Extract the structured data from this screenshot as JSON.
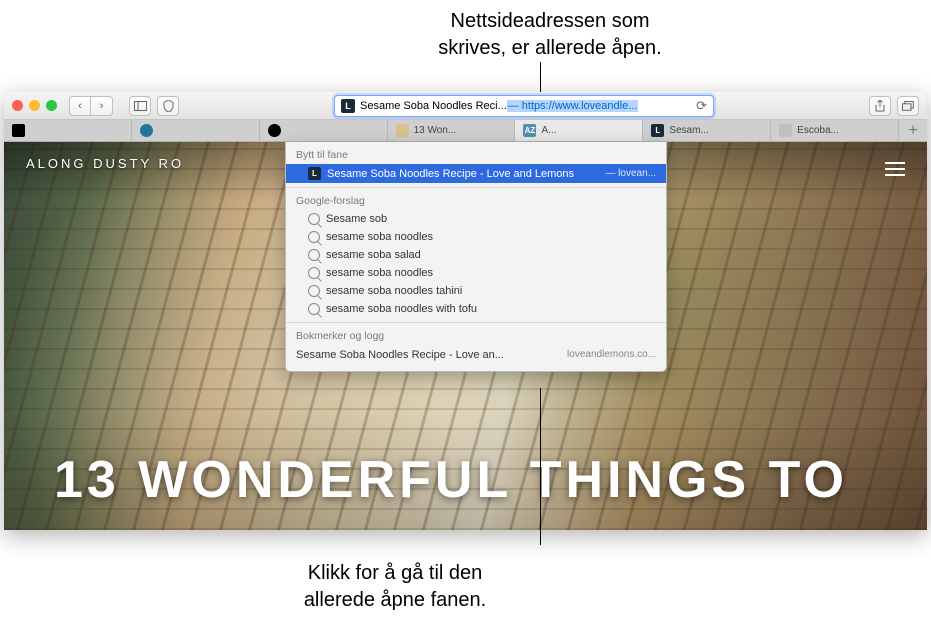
{
  "callouts": {
    "top": "Nettsideadressen som\nskrives, er allerede åpen.",
    "bottom": "Klikk for å gå til den\nallerede åpne fanen."
  },
  "addressBar": {
    "faviconLetter": "L",
    "text1": "Sesame Soba Noodles Reci...",
    "text2": " — https://www.loveandle..."
  },
  "tabs": [
    {
      "label": "",
      "favColor": "#000"
    },
    {
      "label": "",
      "favColor": "#21759b"
    },
    {
      "label": "",
      "favColor": "#000"
    },
    {
      "label": "13 Won...",
      "favColor": "#d8c090"
    },
    {
      "label": "A...",
      "favColor": "#5090b0",
      "active": true
    },
    {
      "label": "Sesam...",
      "favColor": "#1a2a3a",
      "favLetter": "L"
    },
    {
      "label": "Escoba...",
      "favColor": "#c0c0c0"
    }
  ],
  "dropdown": {
    "section1Header": "Bytt til fane",
    "switchItem": {
      "faviconLetter": "L",
      "title": "Sesame Soba Noodles Recipe - Love and Lemons",
      "domain": " — lovean..."
    },
    "section2Header": "Google-forslag",
    "suggestions": [
      "Sesame sob",
      "sesame soba noodles",
      "sesame soba salad",
      "sesame soba noodles",
      "sesame soba noodles tahini",
      "sesame soba noodles with tofu"
    ],
    "section3Header": "Bokmerker og logg",
    "bookmark": {
      "title": "Sesame Soba Noodles Recipe - Love an...",
      "url": "loveandlemons.co..."
    }
  },
  "page": {
    "siteHeader": "ALONG DUSTY RO",
    "heroTitle": "13 WONDERFUL THINGS TO"
  }
}
